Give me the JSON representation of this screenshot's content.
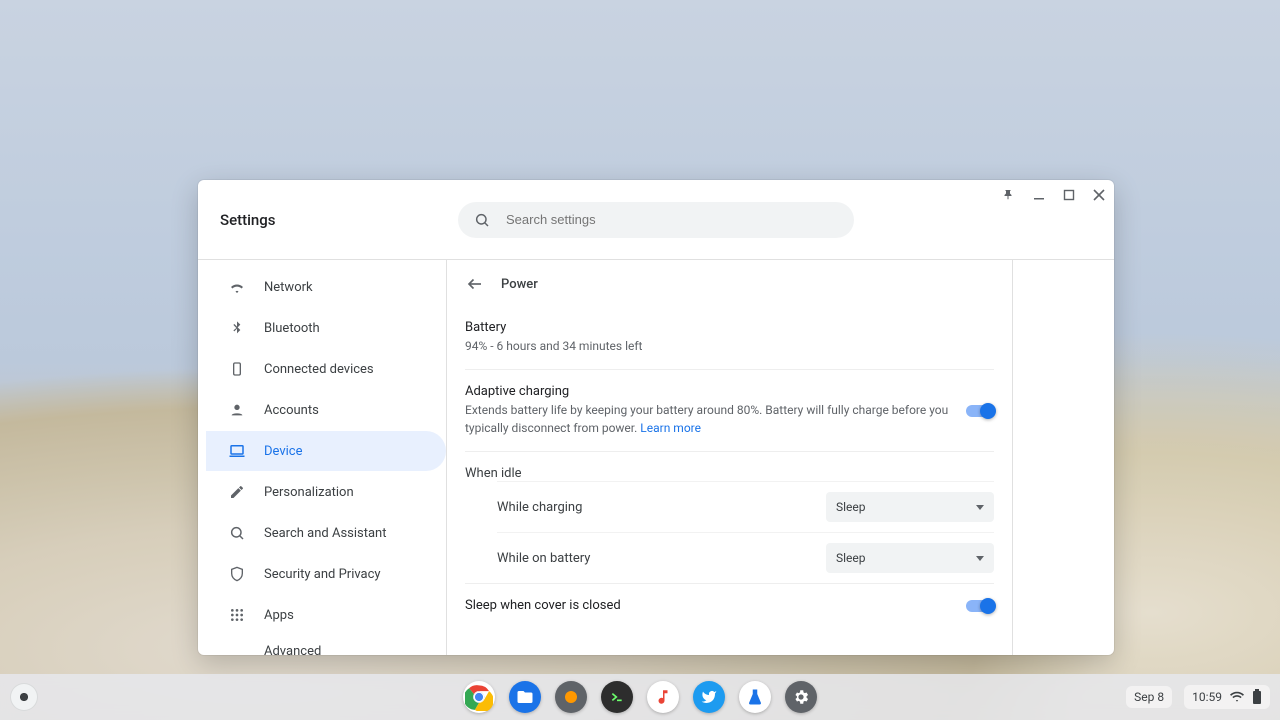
{
  "window": {
    "title": "Settings",
    "controls": {
      "pin": "pin-icon",
      "minimize": "minimize-icon",
      "maximize": "maximize-icon",
      "close": "close-icon"
    }
  },
  "search": {
    "placeholder": "Search settings"
  },
  "sidebar": {
    "items": [
      {
        "icon": "wifi-icon",
        "label": "Network"
      },
      {
        "icon": "bluetooth-icon",
        "label": "Bluetooth"
      },
      {
        "icon": "devices-icon",
        "label": "Connected devices"
      },
      {
        "icon": "account-icon",
        "label": "Accounts"
      },
      {
        "icon": "laptop-icon",
        "label": "Device",
        "active": true
      },
      {
        "icon": "pencil-icon",
        "label": "Personalization"
      },
      {
        "icon": "search-icon",
        "label": "Search and Assistant"
      },
      {
        "icon": "shield-icon",
        "label": "Security and Privacy"
      },
      {
        "icon": "apps-icon",
        "label": "Apps"
      },
      {
        "icon": "",
        "label": "Advanced"
      }
    ]
  },
  "page": {
    "title": "Power",
    "battery": {
      "label": "Battery",
      "status": "94% - 6 hours and 34 minutes left"
    },
    "adaptive": {
      "label": "Adaptive charging",
      "desc": "Extends battery life by keeping your battery around 80%. Battery will fully charge before you typically disconnect from power.  ",
      "learn": "Learn more",
      "enabled": true
    },
    "idle": {
      "header": "When idle",
      "charging": {
        "label": "While charging",
        "value": "Sleep"
      },
      "battery": {
        "label": "While on battery",
        "value": "Sleep"
      }
    },
    "sleep_cover": {
      "label": "Sleep when cover is closed",
      "enabled": true
    }
  },
  "shelf": {
    "apps": [
      {
        "name": "chrome",
        "color1": "#ea4335",
        "color2": "#fbbc05",
        "color3": "#34a853",
        "color4": "#4285f4"
      },
      {
        "name": "files",
        "color": "#1a73e8"
      },
      {
        "name": "app3",
        "color": "#5f6368"
      },
      {
        "name": "terminal",
        "color": "#202124"
      },
      {
        "name": "music",
        "color": "#ea4335"
      },
      {
        "name": "twitter",
        "color": "#1d9bf0"
      },
      {
        "name": "lab",
        "color": "#1a73e8"
      },
      {
        "name": "settings",
        "color": "#5f6368"
      }
    ],
    "date": "Sep 8",
    "time": "10:59"
  }
}
